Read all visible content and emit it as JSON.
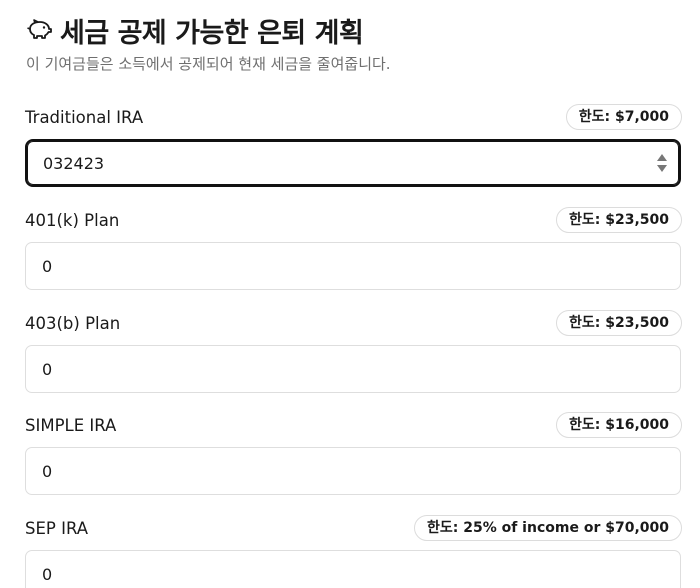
{
  "header": {
    "icon": "piggy-bank-icon",
    "title": "세금 공제 가능한 은퇴 계획",
    "subtitle": "이 기여금들은 소득에서 공제되어 현재 세금을 줄여줍니다."
  },
  "fields": [
    {
      "label": "Traditional IRA",
      "limit": "한도: $7,000",
      "value": "032423"
    },
    {
      "label": "401(k) Plan",
      "limit": "한도: $23,500",
      "value": "0"
    },
    {
      "label": "403(b) Plan",
      "limit": "한도: $23,500",
      "value": "0"
    },
    {
      "label": "SIMPLE IRA",
      "limit": "한도: $16,000",
      "value": "0"
    },
    {
      "label": "SEP IRA",
      "limit": "한도: 25% of income or $70,000",
      "value": "0"
    }
  ],
  "colors": {
    "text": "#1a1a1a",
    "muted": "#6f6f6f",
    "border": "#dedede",
    "focus": "#111111"
  }
}
